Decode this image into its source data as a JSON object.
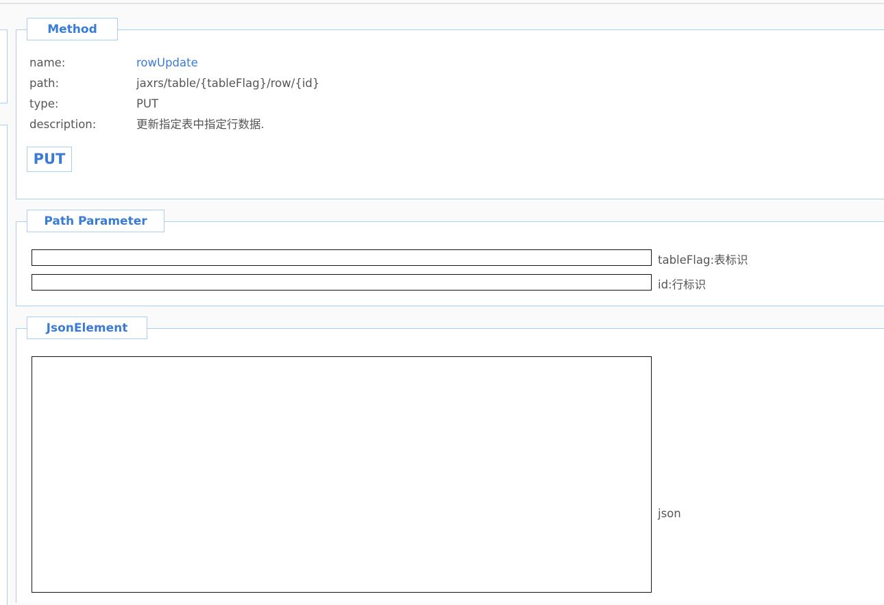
{
  "method": {
    "legend": "Method",
    "fields": [
      {
        "key": "name:",
        "value": "rowUpdate"
      },
      {
        "key": "path:",
        "value": "jaxrs/table/{tableFlag}/row/{id}"
      },
      {
        "key": "type:",
        "value": "PUT"
      },
      {
        "key": "description:",
        "value": "更新指定表中指定行数据."
      }
    ],
    "button_label": "PUT"
  },
  "path_parameter": {
    "legend": "Path Parameter",
    "params": [
      {
        "label": "tableFlag:表标识",
        "value": ""
      },
      {
        "label": "id:行标识",
        "value": ""
      }
    ]
  },
  "json_element": {
    "legend": "JsonElement",
    "label": "json",
    "value": ""
  }
}
